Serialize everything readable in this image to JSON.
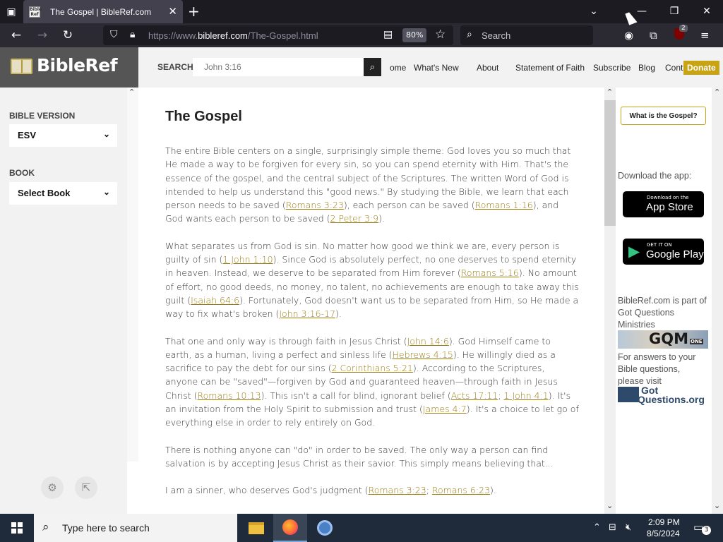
{
  "browser": {
    "tab_title": "The Gospel | BibleRef.com",
    "favicon_text": "Bible Ref",
    "url_prefix": "https://www.",
    "url_domain": "bibleref.com",
    "url_path": "/The-Gospel.html",
    "zoom": "80%",
    "search_placeholder": "Search",
    "extension_badge": "2"
  },
  "site": {
    "logo": "BibleRef",
    "search_label": "SEARCH",
    "search_placeholder": "John 3:16",
    "nav": [
      "ome",
      "What's New",
      "About",
      "Statement of Faith",
      "Subscribe",
      "Blog",
      "Contact"
    ],
    "donate": "Donate"
  },
  "left_sidebar": {
    "version_label": "BIBLE VERSION",
    "version_value": "ESV",
    "book_label": "BOOK",
    "book_value": "Select Book"
  },
  "article": {
    "title": "The Gospel",
    "paragraphs": [
      [
        {
          "t": "The entire Bible centers on a single, surprisingly simple theme: God loves you so much that He made a way to be forgiven for every sin, so you can spend eternity with Him. That's the essence of the gospel, and the central subject of the Scriptures. The written Word of God is intended to help us understand this \"good news.\" By studying the Bible, we learn that each person needs to be saved ("
        },
        {
          "l": "Romans 3:23"
        },
        {
          "t": "), each person can be saved ("
        },
        {
          "l": "Romans 1:16"
        },
        {
          "t": "), and God wants each person to be saved ("
        },
        {
          "l": "2 Peter 3:9"
        },
        {
          "t": ")."
        }
      ],
      [
        {
          "t": "What separates us from God is sin. No matter how good we think we are, every person is guilty of sin ("
        },
        {
          "l": "1 John 1:10"
        },
        {
          "t": "). Since God is absolutely perfect, no one deserves to spend eternity in heaven. Instead, we deserve to be separated from Him forever ("
        },
        {
          "l": "Romans 5:16"
        },
        {
          "t": "). No amount of effort, no good deeds, no money, no talent, no achievements are enough to take away this guilt ("
        },
        {
          "l": "Isaiah 64:6"
        },
        {
          "t": "). Fortunately, God doesn't want us to be separated from Him, so He made a way to fix what's broken ("
        },
        {
          "l": "John 3:16-17"
        },
        {
          "t": ")."
        }
      ],
      [
        {
          "t": "That one and only way is through faith in Jesus Christ ("
        },
        {
          "l": "John 14:6"
        },
        {
          "t": "). God Himself came to earth, as a human, living a perfect and sinless life ("
        },
        {
          "l": "Hebrews 4:15"
        },
        {
          "t": "). He willingly died as a sacrifice to pay the debt for our sins ("
        },
        {
          "l": "2 Corinthians 5:21"
        },
        {
          "t": "). According to the Scriptures, anyone can be \"saved\"—forgiven by God and guaranteed heaven—through faith in Jesus Christ ("
        },
        {
          "l": "Romans 10:13"
        },
        {
          "t": "). This isn't a call for blind, ignorant belief ("
        },
        {
          "l": "Acts 17:11"
        },
        {
          "t": "; "
        },
        {
          "l": "1 John 4:1"
        },
        {
          "t": "). It's an invitation from the Holy Spirit to submission and trust ("
        },
        {
          "l": "James 4:7"
        },
        {
          "t": "). It's a choice to let go of everything else in order to rely entirely on God."
        }
      ],
      [
        {
          "t": "There is nothing anyone can \"do\" in order to be saved. The only way a person can find salvation is by accepting Jesus Christ as their savior. This simply means believing that..."
        }
      ],
      [
        {
          "t": "I am a sinner, who deserves God's judgment ("
        },
        {
          "l": "Romans 3:23"
        },
        {
          "t": "; "
        },
        {
          "l": "Romans 6:23"
        },
        {
          "t": ")."
        }
      ]
    ]
  },
  "right_sidebar": {
    "gospel_button": "What is the Gospel?",
    "download_label": "Download the app:",
    "appstore_small": "Download on the",
    "appstore_big": "App Store",
    "googleplay_small": "GET IT ON",
    "googleplay_big": "Google Play",
    "part_of": "BibleRef.com is part of Got Questions Ministries",
    "gqm": "GQM",
    "gqm_suffix": "ONE",
    "answers": "For answers to your Bible questions, please visit",
    "gq_line1": "Got",
    "gq_line2": "Questions.org"
  },
  "taskbar": {
    "search_placeholder": "Type here to search",
    "time": "2:09 PM",
    "date": "8/5/2024",
    "notification_count": "3"
  }
}
